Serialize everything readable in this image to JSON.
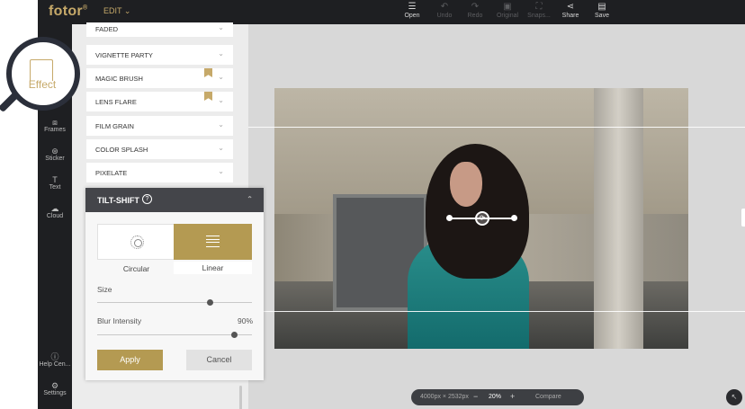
{
  "app": {
    "logo": "fotor",
    "logo_mark": "®",
    "menu_label": "EDIT"
  },
  "toolbar": [
    {
      "label": "Open",
      "icon": "menu-icon",
      "enabled": true
    },
    {
      "label": "Undo",
      "icon": "undo-icon",
      "enabled": false
    },
    {
      "label": "Redo",
      "icon": "redo-icon",
      "enabled": false
    },
    {
      "label": "Original",
      "icon": "original-icon",
      "enabled": false
    },
    {
      "label": "Snaps...",
      "icon": "snapshot-icon",
      "enabled": false
    },
    {
      "label": "Share",
      "icon": "share-icon",
      "enabled": true
    },
    {
      "label": "Save",
      "icon": "save-icon",
      "enabled": true
    }
  ],
  "sidebar": {
    "active": "Effect",
    "items": [
      {
        "label": "Frames",
        "icon": "frame-icon"
      },
      {
        "label": "Sticker",
        "icon": "sticker-icon"
      },
      {
        "label": "Text",
        "icon": "text-icon"
      },
      {
        "label": "Cloud",
        "icon": "cloud-icon"
      }
    ],
    "bottom": [
      {
        "label": "Help Cen...",
        "icon": "help-icon"
      },
      {
        "label": "Settings",
        "icon": "settings-icon"
      }
    ]
  },
  "effects": [
    {
      "label": "FADED",
      "premium": false
    },
    {
      "label": "VIGNETTE PARTY",
      "premium": false
    },
    {
      "label": "MAGIC BRUSH",
      "premium": true
    },
    {
      "label": "LENS FLARE",
      "premium": true
    },
    {
      "label": "FILM GRAIN",
      "premium": false
    },
    {
      "label": "COLOR SPLASH",
      "premium": false
    },
    {
      "label": "PIXELATE",
      "premium": false
    }
  ],
  "tilt_shift": {
    "title": "TILT-SHIFT",
    "help": "?",
    "modes": [
      {
        "label": "Circular"
      },
      {
        "label": "Linear"
      }
    ],
    "selected_mode": "Linear",
    "size": {
      "label": "Size",
      "value": 0.74
    },
    "blur": {
      "label": "Blur Intensity",
      "value_label": "90%",
      "value": 0.9
    },
    "apply_label": "Apply",
    "cancel_label": "Cancel"
  },
  "status": {
    "dimensions": "4000px × 2532px",
    "minus": "−",
    "zoom": "20%",
    "plus": "+",
    "compare": "Compare"
  },
  "colors": {
    "accent": "#b49a52",
    "dark": "#1e1f22",
    "panel": "#ececec"
  }
}
